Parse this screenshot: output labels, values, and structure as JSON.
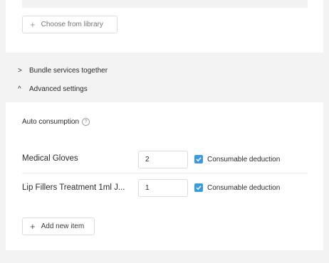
{
  "library": {
    "button_label": "Choose from library",
    "plus_icon": "plus-icon"
  },
  "sections": {
    "bundle": {
      "label": "Bundle services together",
      "icon": "chevron-right-icon"
    },
    "advanced": {
      "label": "Advanced settings",
      "icon": "chevron-up-icon"
    }
  },
  "auto_consumption": {
    "label": "Auto consumption",
    "help_icon": "help-circle-icon"
  },
  "items": [
    {
      "name": "Medical Gloves",
      "quantity": "2",
      "checked": true,
      "checkbox_label": "Consumable deduction"
    },
    {
      "name": "Lip Fillers Treatment 1ml J...",
      "quantity": "1",
      "checked": true,
      "checkbox_label": "Consumable deduction"
    }
  ],
  "add_item": {
    "button_label": "Add new item"
  },
  "colors": {
    "accent": "#3a9be0",
    "background": "#f3f3f4",
    "card": "#ffffff"
  }
}
